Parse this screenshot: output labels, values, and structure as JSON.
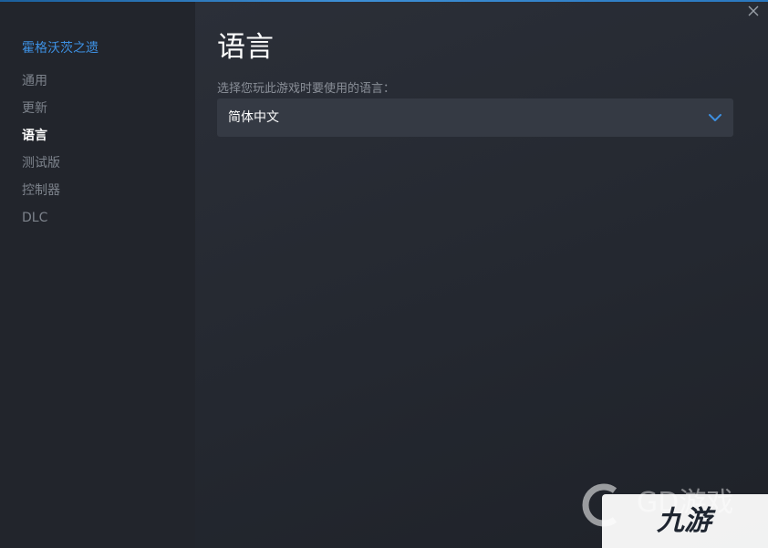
{
  "sidebar": {
    "game_title": "霍格沃茨之遗",
    "items": [
      {
        "label": "通用",
        "active": false
      },
      {
        "label": "更新",
        "active": false
      },
      {
        "label": "语言",
        "active": true
      },
      {
        "label": "测试版",
        "active": false
      },
      {
        "label": "控制器",
        "active": false
      },
      {
        "label": "DLC",
        "active": false
      }
    ]
  },
  "main": {
    "title": "语言",
    "subtitle": "选择您玩此游戏时要使用的语言：",
    "language_select": {
      "selected": "简体中文"
    }
  },
  "watermark": {
    "text_1": "GD游戏",
    "text_2": "九游"
  },
  "icons": {
    "close": "close-icon",
    "dropdown": "chevron-down-icon"
  },
  "colors": {
    "accent": "#3d8fe0",
    "chevron": "#3d8fe0",
    "active_nav": "#ffffff",
    "inactive_nav": "#7d838c"
  }
}
